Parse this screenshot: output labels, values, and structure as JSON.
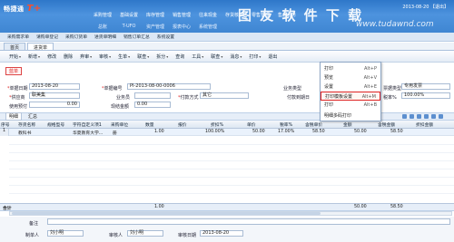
{
  "app": {
    "logo_text": "畅捷通",
    "logo_tplus": "T+",
    "top_info": "2013-08-20 【退出】",
    "watermark": "图 友 软 件 下 载",
    "watermark_url": "www.tudawnd.com"
  },
  "main_menu": [
    "采购管理",
    "基础设置",
    "库存管理",
    "销售管理",
    "往来现金",
    "存货核算",
    "零售管理",
    "售后服务"
  ],
  "main_menu2": [
    "总账",
    "T-UFO",
    "资产管理",
    "报表中心",
    "系统管理"
  ],
  "quick_bar": [
    "采购需求单",
    "请购单登记",
    "采购订货单",
    "进货单明细",
    "销售订单汇总",
    "系统设置"
  ],
  "tabs": [
    "首页",
    "进货单"
  ],
  "toolbar": [
    {
      "label": "开始",
      "dropdown": true
    },
    {
      "label": "新增",
      "dropdown": true
    },
    {
      "label": "修改",
      "dropdown": false
    },
    {
      "label": "删除",
      "dropdown": false
    },
    {
      "label": "弃审",
      "dropdown": true
    },
    {
      "label": "审核",
      "dropdown": true
    },
    {
      "label": "生单",
      "dropdown": true
    },
    {
      "label": "联查",
      "dropdown": true
    },
    {
      "label": "拆分",
      "dropdown": true
    },
    {
      "label": "查询",
      "dropdown": false
    },
    {
      "label": "工具",
      "dropdown": true
    },
    {
      "label": "联查",
      "dropdown": true
    },
    {
      "label": "消息",
      "dropdown": true
    },
    {
      "label": "打印",
      "dropdown": true
    },
    {
      "label": "退出",
      "dropdown": false
    }
  ],
  "print_menu": {
    "items": [
      {
        "label": "打印",
        "key": "Alt+P"
      },
      {
        "label": "预览",
        "key": "Alt+V"
      },
      {
        "label": "设置",
        "key": "Alt+E"
      },
      {
        "label": "打印模板设置",
        "key": "Alt+M"
      },
      {
        "label": "打印",
        "key": "Alt+B"
      },
      {
        "label": "明细多码打印",
        "key": ""
      }
    ],
    "highlighted_index": 3
  },
  "voucher_type": "蓝单",
  "form": {
    "date_label": "单据日期",
    "date_value": "2013-08-20",
    "code_label": "单据编号",
    "code_value": "PI-2013-08-00-0006",
    "business_type_label": "业务类型",
    "business_type_value": "普通采购",
    "invoice_type_label": "票据类型",
    "invoice_type_value": "专用发票",
    "supplier_label": "供应商",
    "supplier_value": "联美集",
    "salesman_label": "业务员",
    "salesman_value": "",
    "payment_label": "付款方式",
    "payment_value": "其它",
    "due_date_label": "付款到期日",
    "due_date_value": "",
    "tax_rate_label": "税率%",
    "tax_rate_value": "100.00%",
    "rebate_label": "使用预付",
    "rebate_value": "0.00",
    "cash_label": "现结金额",
    "cash_value": "0.00"
  },
  "sub_tabs": [
    "明细",
    "汇总"
  ],
  "grid": {
    "headers": [
      "序号",
      "存货名称",
      "规格型号",
      "字符自定义项1",
      "采购单位",
      "数量",
      "报价",
      "折扣%",
      "单价",
      "税率%",
      "含税单价",
      "金额",
      "含税金额",
      "折扣金额"
    ],
    "rows": [
      {
        "no": "1",
        "name": "教科书",
        "spec": "",
        "custom": "华夏教育大学...",
        "unit": "册",
        "qty": "1.00",
        "quote": "",
        "discount": "100.00%",
        "price": "50.00",
        "tax_rate": "17.00%",
        "tax_price": "58.50",
        "amount": "50.00",
        "tax_amount": "58.50",
        "disc_amount": ""
      }
    ]
  },
  "totals": {
    "label": "合计",
    "qty": "1.00",
    "amount": "50.00",
    "tax_amount": "58.50"
  },
  "footer": {
    "remark_label": "备注",
    "maker_label": "制单人",
    "maker_value": "刘小明",
    "auditor_label": "审核人",
    "auditor_value": "刘小明",
    "audit_date_label": "审核日期",
    "audit_date_value": "2013-08-20"
  }
}
